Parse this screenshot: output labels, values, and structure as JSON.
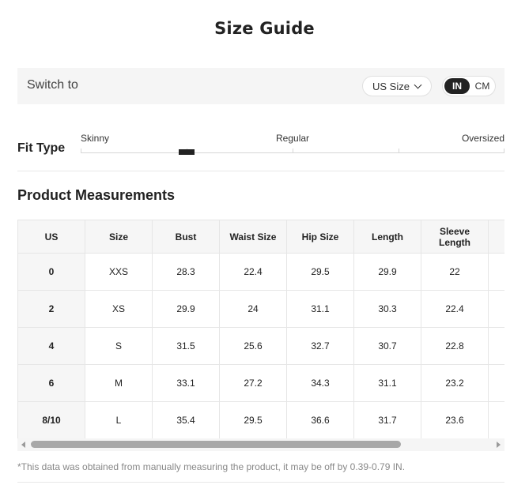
{
  "title": "Size Guide",
  "switch": {
    "label": "Switch to",
    "size_system": "US Size",
    "units": {
      "in": "IN",
      "cm": "CM",
      "selected": "IN"
    }
  },
  "fit": {
    "label": "Fit Type",
    "skinny": "Skinny",
    "regular": "Regular",
    "oversized": "Oversized",
    "marker_position": 0.25
  },
  "measurements": {
    "title": "Product Measurements",
    "headers": [
      "US",
      "Size",
      "Bust",
      "Waist Size",
      "Hip Size",
      "Length",
      "Sleeve Length",
      ""
    ],
    "rows": [
      [
        "0",
        "XXS",
        "28.3",
        "22.4",
        "29.5",
        "29.9",
        "22",
        ""
      ],
      [
        "2",
        "XS",
        "29.9",
        "24",
        "31.1",
        "30.3",
        "22.4",
        ""
      ],
      [
        "4",
        "S",
        "31.5",
        "25.6",
        "32.7",
        "30.7",
        "22.8",
        ""
      ],
      [
        "6",
        "M",
        "33.1",
        "27.2",
        "34.3",
        "31.1",
        "23.2",
        ""
      ],
      [
        "8/10",
        "L",
        "35.4",
        "29.5",
        "36.6",
        "31.7",
        "23.6",
        ""
      ]
    ]
  },
  "note": "*This data was obtained from manually measuring the product, it may be off by 0.39-0.79 IN.",
  "colors": {
    "accent": "#222222",
    "panel": "#f5f5f5",
    "border": "#e6e6e6"
  }
}
